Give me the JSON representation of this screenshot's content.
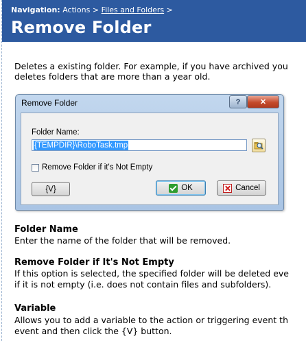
{
  "header": {
    "nav_label": "Navigation:",
    "nav_item_1": "Actions",
    "nav_sep_1": ">",
    "nav_item_2": "Files and Folders",
    "nav_sep_2": ">",
    "title": "Remove Folder"
  },
  "intro": {
    "line1": "Deletes a existing folder. For example, if you have archived you",
    "line2": "deletes folders that are more than a year old."
  },
  "dialog": {
    "title": "Remove Folder",
    "help_label": "?",
    "close_label": "✕",
    "folder_name_label": "Folder Name:",
    "folder_name_value": "{TEMPDIR}\\RoboTask.tmp",
    "remove_if_not_empty_label": "Remove Folder if it's Not Empty",
    "remove_if_not_empty_checked": false,
    "variable_button": "{V}",
    "ok_button": "OK",
    "cancel_button": "Cancel"
  },
  "sections": [
    {
      "heading": "Folder Name",
      "line1": "Enter the name of the folder that will be removed.",
      "line2": ""
    },
    {
      "heading": "Remove Folder if It's Not Empty",
      "line1": "If this option is selected, the specified folder will be deleted eve",
      "line2": "if it is not empty (i.e. does not contain files and subfolders)."
    },
    {
      "heading": "Variable",
      "line1": "Allows you to add a variable to the action or triggering event th",
      "line2": "event and then click the {V} button."
    }
  ],
  "colors": {
    "header_bg": "#2d5aa0",
    "selection": "#3399ff"
  },
  "icons": {
    "browse": "folder-browse-icon",
    "ok": "check-icon",
    "cancel": "cancel-x-icon"
  }
}
